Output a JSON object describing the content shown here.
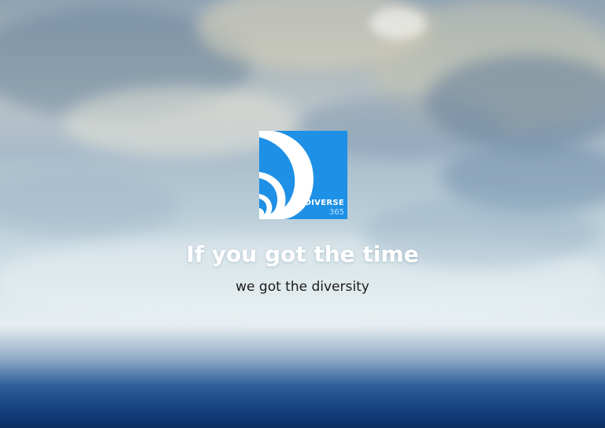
{
  "logo": {
    "word": "DIVERSE",
    "number": "365",
    "background_color": "#1e90e6"
  },
  "hero": {
    "headline": "If you got the time",
    "subline": "we got the diversity"
  }
}
